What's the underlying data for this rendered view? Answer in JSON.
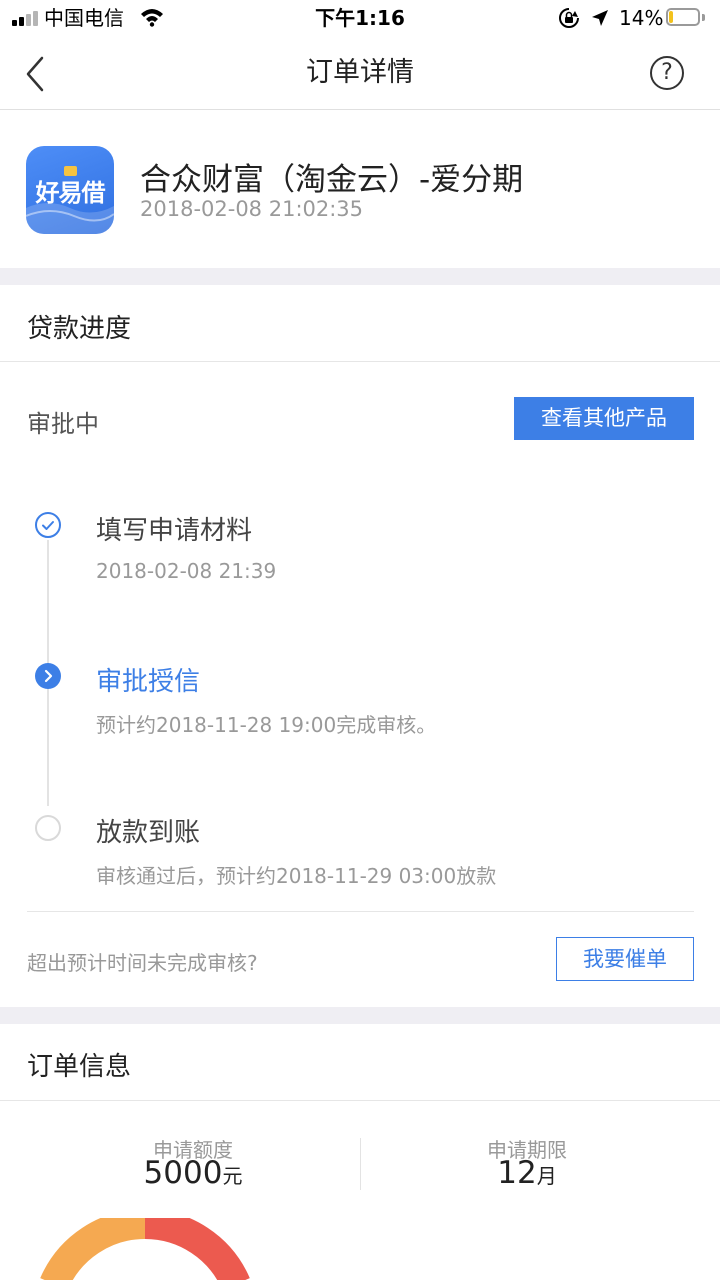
{
  "status_bar": {
    "carrier": "中国电信",
    "time": "下午1:16",
    "battery_text": "14%",
    "battery_level": 0.14
  },
  "nav": {
    "title": "订单详情",
    "help_icon_text": "?"
  },
  "product": {
    "logo_text": "好易借",
    "name": "合众财富（淘金云）-爱分期",
    "time": "2018-02-08 21:02:35"
  },
  "progress_section": {
    "title": "贷款进度",
    "status": "审批中",
    "view_other_label": "查看其他产品",
    "steps": [
      {
        "title": "填写申请材料",
        "desc": "2018-02-08 21:39",
        "state": "done"
      },
      {
        "title": "审批授信",
        "desc": "预计约2018-11-28 19:00完成审核。",
        "state": "current"
      },
      {
        "title": "放款到账",
        "desc": "审核通过后，预计约2018-11-29 03:00放款",
        "state": "pending"
      }
    ],
    "urge_question": "超出预计时间未完成审核?",
    "urge_label": "我要催单"
  },
  "order_section": {
    "title": "订单信息",
    "amount_label": "申请额度",
    "amount_value": "5000",
    "amount_unit": "元",
    "term_label": "申请期限",
    "term_value": "12",
    "term_unit": "月"
  },
  "colors": {
    "accent": "#3d7fe6",
    "donut_red": "#ec5a4f",
    "donut_orange": "#f5a951",
    "battery": "#f3c21c"
  }
}
